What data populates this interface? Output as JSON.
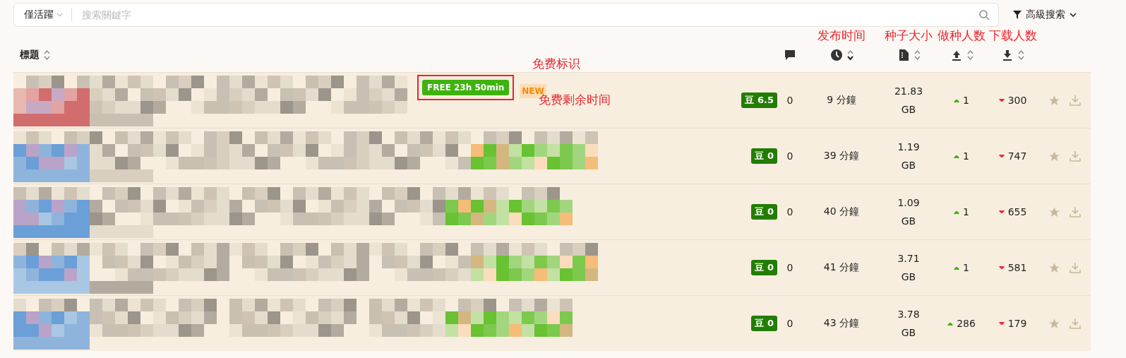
{
  "filter": {
    "value": "僅活躍"
  },
  "search": {
    "placeholder": "搜索關鍵字"
  },
  "advanced_search": {
    "label": "高級搜索"
  },
  "table": {
    "columns": [
      {
        "kind": "title",
        "label": "標題",
        "sortable": true,
        "descending": false
      },
      {
        "kind": "comments",
        "sortable": false
      },
      {
        "kind": "time",
        "sortable": true,
        "descending": true,
        "annotation": "发布时间"
      },
      {
        "kind": "size",
        "sortable": true,
        "descending": false,
        "annotation": "种子大小"
      },
      {
        "kind": "seeders",
        "sortable": true,
        "descending": false,
        "annotation": "做种人数"
      },
      {
        "kind": "leechers",
        "sortable": true,
        "descending": false,
        "annotation": "下载人数"
      }
    ],
    "rows": [
      {
        "free": {
          "label": "FREE 23h 50min",
          "annotation": "免费标识",
          "time_annotation": "免费剩余时间"
        },
        "new": "NEW",
        "douban": "豆",
        "score": "6.5",
        "comments": "0",
        "time": "9 分鐘",
        "size": "21.83 GB",
        "seeders": "1",
        "leechers": "300"
      },
      {
        "douban": "豆",
        "score": "0",
        "comments": "0",
        "time": "39 分鐘",
        "size": "1.19 GB",
        "seeders": "1",
        "leechers": "747"
      },
      {
        "douban": "豆",
        "score": "0",
        "comments": "0",
        "time": "40 分鐘",
        "size": "1.09 GB",
        "seeders": "1",
        "leechers": "655"
      },
      {
        "douban": "豆",
        "score": "0",
        "comments": "0",
        "time": "41 分鐘",
        "size": "3.71 GB",
        "seeders": "1",
        "leechers": "581"
      },
      {
        "douban": "豆",
        "score": "0",
        "comments": "0",
        "time": "43 分鐘",
        "size": "3.78 GB",
        "seeders": "286",
        "leechers": "179"
      }
    ]
  }
}
